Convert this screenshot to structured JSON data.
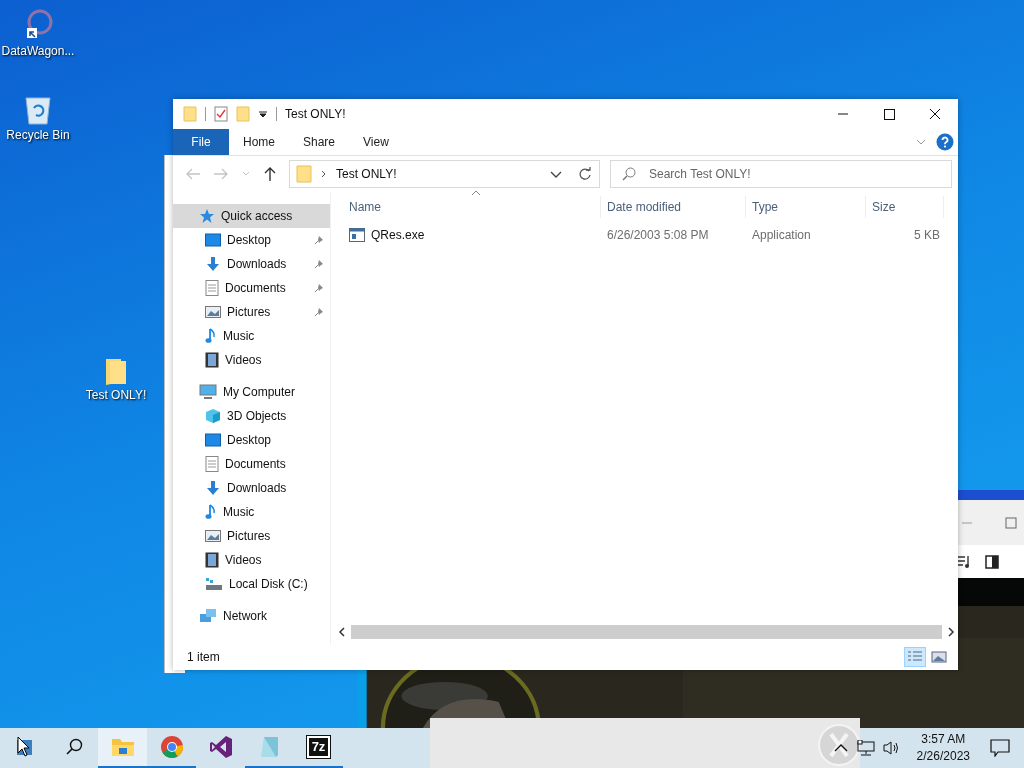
{
  "desktop_icons": [
    {
      "label": "DataWagon...",
      "kind": "shortcut"
    },
    {
      "label": "Recycle Bin",
      "kind": "recycle"
    },
    {
      "label": "Test ONLY!",
      "kind": "folder"
    }
  ],
  "explorer": {
    "title": "Test ONLY!",
    "ribbon_tabs": [
      {
        "label": "File",
        "selected": true
      },
      {
        "label": "Home",
        "selected": false
      },
      {
        "label": "Share",
        "selected": false
      },
      {
        "label": "View",
        "selected": false
      }
    ],
    "address": {
      "path": "Test ONLY!"
    },
    "search": {
      "placeholder": "Search Test ONLY!"
    },
    "nav": [
      {
        "label": "Quick access",
        "kind": "star",
        "selected": true,
        "children": [
          {
            "label": "Desktop",
            "kind": "desktop",
            "pinned": true,
            "selected": false
          },
          {
            "label": "Downloads",
            "kind": "downloads",
            "pinned": true,
            "selected": false
          },
          {
            "label": "Documents",
            "kind": "documents",
            "pinned": true,
            "selected": false
          },
          {
            "label": "Pictures",
            "kind": "pictures",
            "pinned": true,
            "selected": false
          },
          {
            "label": "Music",
            "kind": "music",
            "pinned": false,
            "selected": false
          },
          {
            "label": "Videos",
            "kind": "videos",
            "pinned": false,
            "selected": false
          }
        ]
      },
      {
        "label": "My Computer",
        "kind": "computer",
        "selected": false,
        "children": [
          {
            "label": "3D Objects",
            "kind": "objects",
            "pinned": false,
            "selected": false
          },
          {
            "label": "Desktop",
            "kind": "desktop",
            "pinned": false,
            "selected": false
          },
          {
            "label": "Documents",
            "kind": "documents",
            "pinned": false,
            "selected": false
          },
          {
            "label": "Downloads",
            "kind": "downloads",
            "pinned": false,
            "selected": false
          },
          {
            "label": "Music",
            "kind": "music",
            "pinned": false,
            "selected": false
          },
          {
            "label": "Pictures",
            "kind": "pictures",
            "pinned": false,
            "selected": false
          },
          {
            "label": "Videos",
            "kind": "videos",
            "pinned": false,
            "selected": false
          },
          {
            "label": "Local Disk (C:)",
            "kind": "disk",
            "pinned": false,
            "selected": false
          }
        ]
      },
      {
        "label": "Network",
        "kind": "network",
        "selected": false
      }
    ],
    "columns": [
      "Name",
      "Date modified",
      "Type",
      "Size"
    ],
    "rows": [
      {
        "name": "QRes.exe",
        "date": "6/26/2003 5:08 PM",
        "type": "Application",
        "size": "5 KB",
        "selected": false
      }
    ],
    "status": "1 item",
    "views": [
      {
        "kind": "details",
        "selected": true
      },
      {
        "kind": "large",
        "selected": false
      }
    ]
  },
  "taskbar": {
    "apps": [
      {
        "kind": "start",
        "selected": false,
        "open": false
      },
      {
        "kind": "search",
        "selected": false,
        "open": false
      },
      {
        "kind": "explorer",
        "selected": true,
        "open": true
      },
      {
        "kind": "chrome",
        "selected": false,
        "open": true
      },
      {
        "kind": "vs",
        "selected": false,
        "open": false
      },
      {
        "kind": "notepad",
        "selected": false,
        "open": true
      },
      {
        "kind": "sevenzip",
        "label": "7z",
        "selected": false,
        "open": true
      }
    ],
    "time": "3:57 AM",
    "date": "2/26/2023"
  }
}
